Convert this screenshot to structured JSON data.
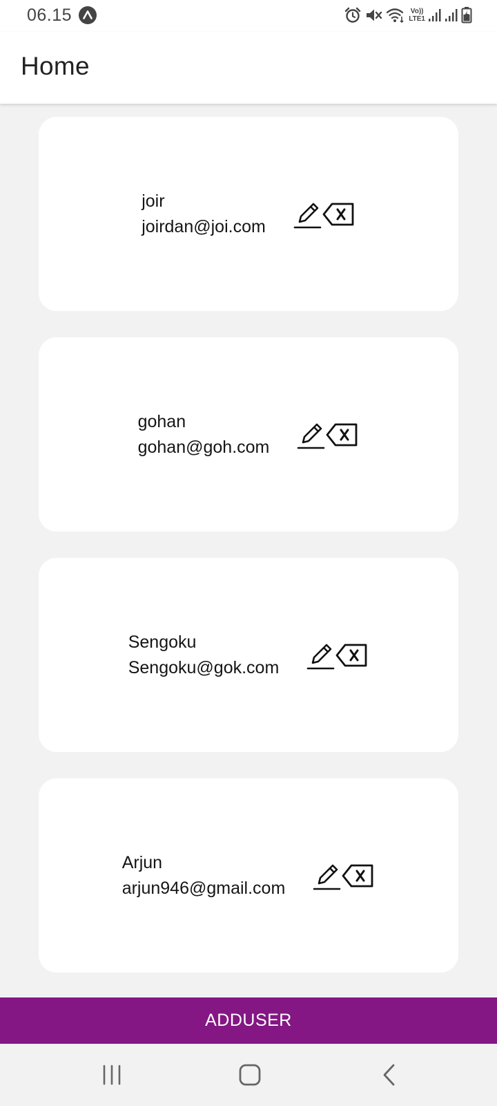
{
  "status_bar": {
    "time": "06.15",
    "app_icon": "arrow-up-circle-icon",
    "indicators": [
      "alarm-icon",
      "mute-icon",
      "wifi-icon",
      "volte-icon",
      "signal-icon",
      "signal-icon",
      "battery-icon"
    ],
    "volte_label": "Vo))",
    "lte_label": "LTE1"
  },
  "app_bar": {
    "title": "Home"
  },
  "users": [
    {
      "name": "joir",
      "email": "joirdan@joi.com"
    },
    {
      "name": "gohan",
      "email": "gohan@goh.com"
    },
    {
      "name": "Sengoku",
      "email": "Sengoku@gok.com"
    },
    {
      "name": "Arjun",
      "email": "arjun946@gmail.com"
    }
  ],
  "actions": {
    "edit_icon": "pencil-icon",
    "delete_icon": "backspace-x-icon"
  },
  "add_user": {
    "label": "ADDUSER"
  },
  "colors": {
    "accent": "#841784",
    "background": "#f2f2f2",
    "card": "#ffffff"
  },
  "nav_bar": {
    "items": [
      "recents-icon",
      "home-icon",
      "back-icon"
    ]
  }
}
